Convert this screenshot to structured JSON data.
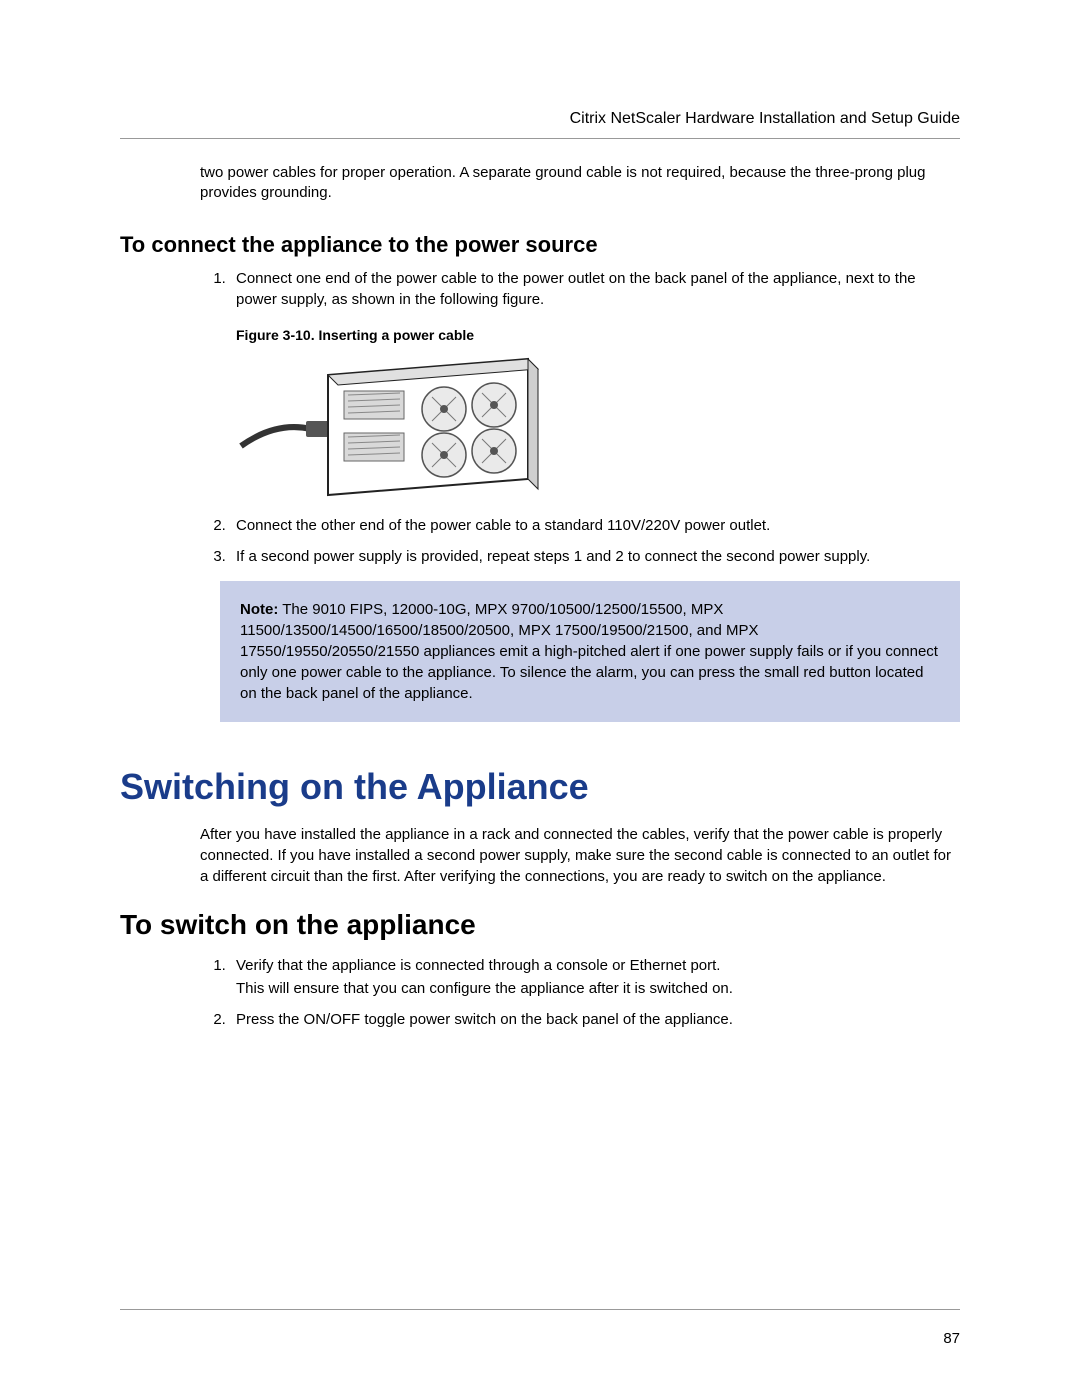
{
  "header": {
    "running_title": "Citrix NetScaler Hardware Installation and Setup Guide"
  },
  "intro_continuation": "two power cables for proper operation. A separate ground cable is not required, because the three-prong plug provides grounding.",
  "connect_section": {
    "heading": "To connect the appliance to the power source",
    "step1": "Connect one end of the power cable to the power outlet on the back panel of the appliance, next to the power supply, as shown in the following figure.",
    "figure_caption": "Figure 3-10. Inserting a power cable",
    "step2": "Connect the other end of the power cable to a standard 110V/220V power outlet.",
    "step3": "If a second power supply is provided, repeat steps 1 and 2 to connect the second power supply.",
    "note_label": "Note:",
    "note_body": " The 9010 FIPS, 12000-10G, MPX 9700/10500/12500/15500, MPX 11500/13500/14500/16500/18500/20500, MPX 17500/19500/21500, and MPX 17550/19550/20550/21550 appliances emit a high-pitched alert if one power supply fails or if you connect only one power cable to the appliance. To silence the alarm, you can press the small red button located on the back panel of the appliance."
  },
  "switching_section": {
    "chapter_title": "Switching on the Appliance",
    "intro": "After you have installed the appliance in a rack and connected the cables, verify that the power cable is properly connected. If you have installed a second power supply, make sure the second cable is connected to an outlet for a different circuit than the first. After verifying the connections, you are ready to switch on the appliance.",
    "task_heading": "To switch on the appliance",
    "step1_line1": "Verify that the appliance is connected through a console or Ethernet port.",
    "step1_line2": "This will ensure that you can configure the appliance after it is switched on.",
    "step2": "Press the ON/OFF toggle power switch on the back panel of the appliance."
  },
  "page_number": "87"
}
